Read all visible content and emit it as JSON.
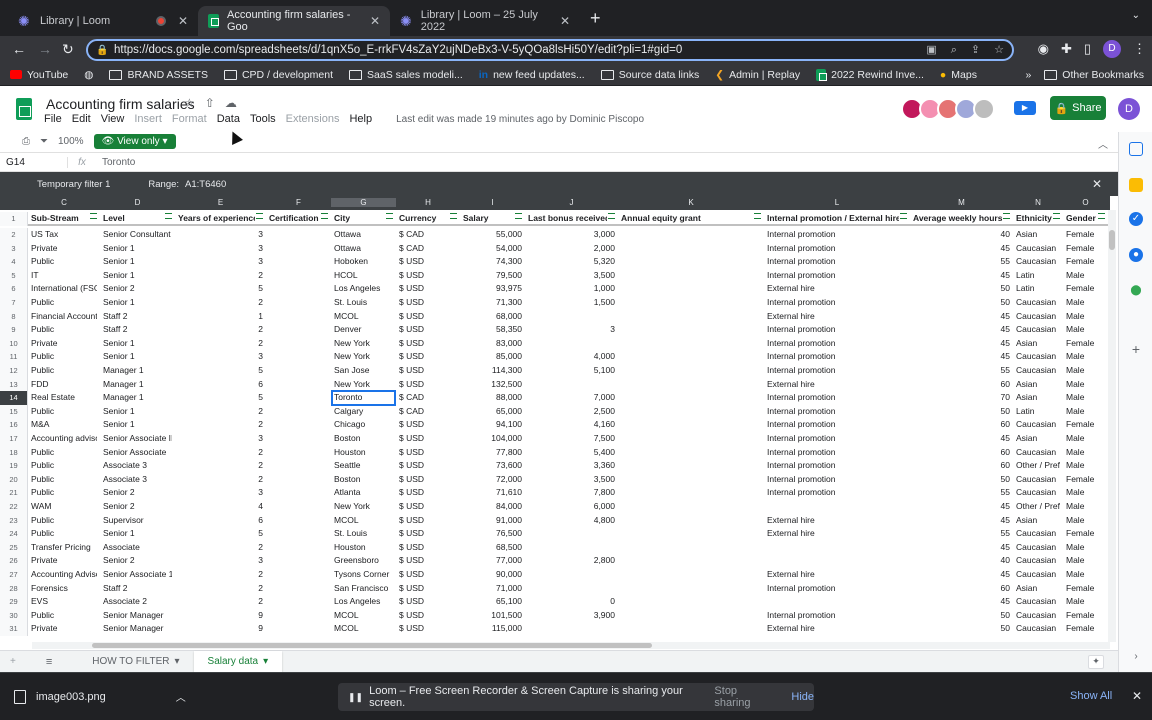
{
  "browser": {
    "tabs": [
      {
        "label": "Library | Loom"
      },
      {
        "label": "Accounting firm salaries - Goo"
      },
      {
        "label": "Library | Loom – 25 July 2022"
      }
    ],
    "url": "https://docs.google.com/spreadsheets/d/1qnX5o_E-rrkFV4sZaY2ujNDeBx3-V-5yQOa8lsHi50Y/edit?pli=1#gid=0",
    "profile_initial": "D",
    "bookmarks": [
      "YouTube",
      "BRAND ASSETS",
      "CPD / development",
      "SaaS sales modeli...",
      "new feed updates...",
      "Source data links",
      "Admin | Replay",
      "2022 Rewind Inve...",
      "Maps"
    ],
    "other_bookmarks": "Other Bookmarks"
  },
  "doc": {
    "title": "Accounting firm salaries",
    "menus": [
      "File",
      "Edit",
      "View",
      "Insert",
      "Format",
      "Data",
      "Tools",
      "Extensions",
      "Help"
    ],
    "last_edit": "Last edit was made 19 minutes ago by Dominic Piscopo",
    "share_label": "Share",
    "user_initial": "D",
    "zoom": "100%",
    "view_mode": "View only"
  },
  "formula_bar": {
    "cell": "G14",
    "fx": "fx",
    "value": "Toronto"
  },
  "filter": {
    "name": "Temporary filter 1",
    "range_label": "Range:",
    "range": "A1:T6460"
  },
  "columns": [
    "C",
    "D",
    "E",
    "F",
    "G",
    "H",
    "I",
    "J",
    "K",
    "L",
    "M",
    "N",
    "O"
  ],
  "headers": [
    "Sub-Stream",
    "Level",
    "Years of experience",
    "Certification",
    "City",
    "Currency",
    "Salary",
    "Last bonus received",
    "Annual equity grant",
    "Internal promotion / External hire",
    "Average weekly hours",
    "Ethnicity",
    "Gender"
  ],
  "rows": [
    {
      "n": "2",
      "c": [
        "US Tax",
        "Senior Consultant",
        "3",
        "",
        "Ottawa",
        "$ CAD",
        "55,000",
        "3,000",
        "",
        "Internal promotion",
        "40",
        "Asian",
        "Female"
      ]
    },
    {
      "n": "3",
      "c": [
        "Private",
        "Senior 1",
        "3",
        "",
        "Ottawa",
        "$ CAD",
        "54,000",
        "2,000",
        "",
        "Internal promotion",
        "45",
        "Caucasian",
        "Female"
      ]
    },
    {
      "n": "4",
      "c": [
        "Public",
        "Senior 1",
        "3",
        "",
        "Hoboken",
        "$ USD",
        "74,300",
        "5,320",
        "",
        "Internal promotion",
        "55",
        "Caucasian",
        "Female"
      ]
    },
    {
      "n": "5",
      "c": [
        "IT",
        "Senior 1",
        "2",
        "",
        "HCOL",
        "$ USD",
        "79,500",
        "3,500",
        "",
        "Internal promotion",
        "45",
        "Latin",
        "Male"
      ]
    },
    {
      "n": "6",
      "c": [
        "International (FSO",
        "Senior 2",
        "5",
        "",
        "Los Angeles",
        "$ USD",
        "93,975",
        "1,000",
        "",
        "External hire",
        "50",
        "Latin",
        "Female"
      ]
    },
    {
      "n": "7",
      "c": [
        "Public",
        "Senior 1",
        "2",
        "",
        "St. Louis",
        "$ USD",
        "71,300",
        "1,500",
        "",
        "Internal promotion",
        "50",
        "Caucasian",
        "Male"
      ]
    },
    {
      "n": "8",
      "c": [
        "Financial Accounti",
        "Staff 2",
        "1",
        "",
        "MCOL",
        "$ USD",
        "68,000",
        "",
        "",
        "External hire",
        "45",
        "Caucasian",
        "Male"
      ]
    },
    {
      "n": "9",
      "c": [
        "Public",
        "Staff 2",
        "2",
        "",
        "Denver",
        "$ USD",
        "58,350",
        "3",
        "",
        "Internal promotion",
        "45",
        "Caucasian",
        "Male"
      ]
    },
    {
      "n": "10",
      "c": [
        "Private",
        "Senior 1",
        "2",
        "",
        "New York",
        "$ USD",
        "83,000",
        "",
        "",
        "Internal promotion",
        "45",
        "Asian",
        "Female"
      ]
    },
    {
      "n": "11",
      "c": [
        "Public",
        "Senior 1",
        "3",
        "",
        "New York",
        "$ USD",
        "85,000",
        "4,000",
        "",
        "Internal promotion",
        "45",
        "Caucasian",
        "Male"
      ]
    },
    {
      "n": "12",
      "c": [
        "Public",
        "Manager 1",
        "5",
        "",
        "San Jose",
        "$ USD",
        "114,300",
        "5,100",
        "",
        "Internal promotion",
        "55",
        "Caucasian",
        "Male"
      ]
    },
    {
      "n": "13",
      "c": [
        "FDD",
        "Manager 1",
        "6",
        "",
        "New York",
        "$ USD",
        "132,500",
        "",
        "",
        "External hire",
        "60",
        "Asian",
        "Male"
      ]
    },
    {
      "n": "14",
      "c": [
        "Real Estate",
        "Manager 1",
        "5",
        "",
        "Toronto",
        "$ CAD",
        "88,000",
        "7,000",
        "",
        "Internal promotion",
        "70",
        "Asian",
        "Male"
      ]
    },
    {
      "n": "15",
      "c": [
        "Public",
        "Senior 1",
        "2",
        "",
        "Calgary",
        "$ CAD",
        "65,000",
        "2,500",
        "",
        "Internal promotion",
        "50",
        "Latin",
        "Male"
      ]
    },
    {
      "n": "16",
      "c": [
        "M&A",
        "Senior 1",
        "2",
        "",
        "Chicago",
        "$ USD",
        "94,100",
        "4,160",
        "",
        "Internal promotion",
        "60",
        "Caucasian",
        "Female"
      ]
    },
    {
      "n": "17",
      "c": [
        "Accounting adviso",
        "Senior Associate II",
        "3",
        "",
        "Boston",
        "$ USD",
        "104,000",
        "7,500",
        "",
        "Internal promotion",
        "45",
        "Asian",
        "Male"
      ]
    },
    {
      "n": "18",
      "c": [
        "Public",
        "Senior Associate",
        "2",
        "",
        "Houston",
        "$ USD",
        "77,800",
        "5,400",
        "",
        "Internal promotion",
        "60",
        "Caucasian",
        "Male"
      ]
    },
    {
      "n": "19",
      "c": [
        "Public",
        "Associate 3",
        "2",
        "",
        "Seattle",
        "$ USD",
        "73,600",
        "3,360",
        "",
        "Internal promotion",
        "60",
        "Other / Prefe",
        "Male"
      ]
    },
    {
      "n": "20",
      "c": [
        "Public",
        "Associate 3",
        "2",
        "",
        "Boston",
        "$ USD",
        "72,000",
        "3,500",
        "",
        "Internal promotion",
        "50",
        "Caucasian",
        "Female"
      ]
    },
    {
      "n": "21",
      "c": [
        "Public",
        "Senior 2",
        "3",
        "",
        "Atlanta",
        "$ USD",
        "71,610",
        "7,800",
        "",
        "Internal promotion",
        "55",
        "Caucasian",
        "Male"
      ]
    },
    {
      "n": "22",
      "c": [
        "WAM",
        "Senior 2",
        "4",
        "",
        "New York",
        "$ USD",
        "84,000",
        "6,000",
        "",
        "",
        "45",
        "Other / Prefe",
        "Male"
      ]
    },
    {
      "n": "23",
      "c": [
        "Public",
        "Supervisor",
        "6",
        "",
        "MCOL",
        "$ USD",
        "91,000",
        "4,800",
        "",
        "External hire",
        "45",
        "Asian",
        "Male"
      ]
    },
    {
      "n": "24",
      "c": [
        "Public",
        "Senior 1",
        "5",
        "",
        "St. Louis",
        "$ USD",
        "76,500",
        "",
        "",
        "External hire",
        "55",
        "Caucasian",
        "Female"
      ]
    },
    {
      "n": "25",
      "c": [
        "Transfer Pricing",
        "Associate",
        "2",
        "",
        "Houston",
        "$ USD",
        "68,500",
        "",
        "",
        "",
        "45",
        "Caucasian",
        "Male"
      ]
    },
    {
      "n": "26",
      "c": [
        "Private",
        "Senior 2",
        "3",
        "",
        "Greensboro",
        "$ USD",
        "77,000",
        "2,800",
        "",
        "",
        "40",
        "Caucasian",
        "Male"
      ]
    },
    {
      "n": "27",
      "c": [
        "Accounting Adviso",
        "Senior Associate 1",
        "2",
        "",
        "Tysons Corner",
        "$ USD",
        "90,000",
        "",
        "",
        "External hire",
        "45",
        "Caucasian",
        "Male"
      ]
    },
    {
      "n": "28",
      "c": [
        "Forensics",
        "Staff 2",
        "2",
        "",
        "San Francisco",
        "$ USD",
        "71,000",
        "",
        "",
        "Internal promotion",
        "60",
        "Asian",
        "Female"
      ]
    },
    {
      "n": "29",
      "c": [
        "EVS",
        "Associate 2",
        "2",
        "",
        "Los Angeles",
        "$ USD",
        "65,100",
        "0",
        "",
        "",
        "45",
        "Caucasian",
        "Male"
      ]
    },
    {
      "n": "30",
      "c": [
        "Public",
        "Senior Manager",
        "9",
        "",
        "MCOL",
        "$ USD",
        "101,500",
        "3,900",
        "",
        "Internal promotion",
        "50",
        "Caucasian",
        "Female"
      ]
    },
    {
      "n": "31",
      "c": [
        "Private",
        "Senior Manager",
        "9",
        "",
        "MCOL",
        "$ USD",
        "115,000",
        "",
        "",
        "External hire",
        "50",
        "Caucasian",
        "Female"
      ]
    }
  ],
  "sheet_tabs": [
    "HOW TO FILTER",
    "Salary data"
  ],
  "download": {
    "file": "image003.png",
    "show_all": "Show All"
  },
  "loom_bar": {
    "text": "Loom – Free Screen Recorder & Screen Capture is sharing your screen.",
    "stop": "Stop sharing",
    "hide": "Hide"
  }
}
